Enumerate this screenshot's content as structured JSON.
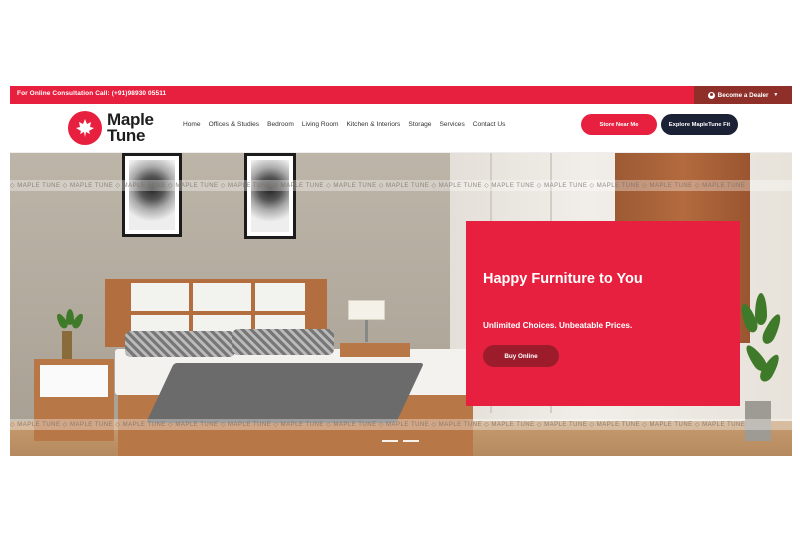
{
  "topbar": {
    "consultation": "For Online Consultation Call: (+91)98930 05511",
    "dealer_label": "Become a Dealer",
    "bg_color": "#e8203f",
    "dealer_bg_color": "#8f2f2a"
  },
  "header": {
    "logo_line1": "Maple",
    "logo_line2": "Tune",
    "logo_icon": "maple-leaf-icon",
    "nav": [
      "Home",
      "Offices & Studies",
      "Bedroom",
      "Living Room",
      "Kitchen & Interiors",
      "Storage",
      "Services",
      "Contact Us"
    ],
    "store_button": "Store Near Me",
    "explore_button": "Explore MapleTune Fit"
  },
  "hero": {
    "watermark": "MAPLE TUNE",
    "headline": "Happy Furniture to You",
    "subheadline": "Unlimited Choices. Unbeatable Prices.",
    "cta": "Buy Online",
    "promo_color": "#e8203f",
    "slides_total": 2,
    "slide_active": 1
  }
}
